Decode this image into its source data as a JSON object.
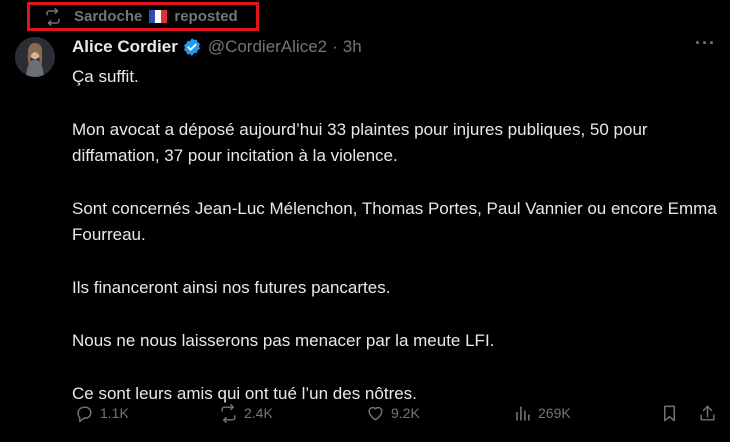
{
  "repost": {
    "user": "Sardoche",
    "label": "reposted"
  },
  "tweet": {
    "name": "Alice Cordier",
    "handle": "@CordierAlice2",
    "separator": "·",
    "time": "3h",
    "lines": [
      "Ça suffit.",
      "Mon avocat a déposé aujourd’hui 33 plaintes pour injures publiques, 50 pour diffamation, 37 pour incitation à la violence.",
      "Sont concernés Jean-Luc Mélenchon, Thomas Portes, Paul Vannier ou encore Emma Fourreau.",
      "Ils financeront ainsi nos futures pancartes.",
      "Nous ne nous laisserons pas menacer par la meute LFI.",
      "Ce sont leurs amis qui ont tué l’un des nôtres."
    ]
  },
  "actions": {
    "replies": "1.1K",
    "reposts": "2.4K",
    "likes": "9.2K",
    "views": "269K"
  },
  "colors": {
    "background": "#000000",
    "text": "#e7e9ea",
    "muted": "#71767b",
    "highlight_border": "#e0151c",
    "verified": "#1d9bf0"
  }
}
